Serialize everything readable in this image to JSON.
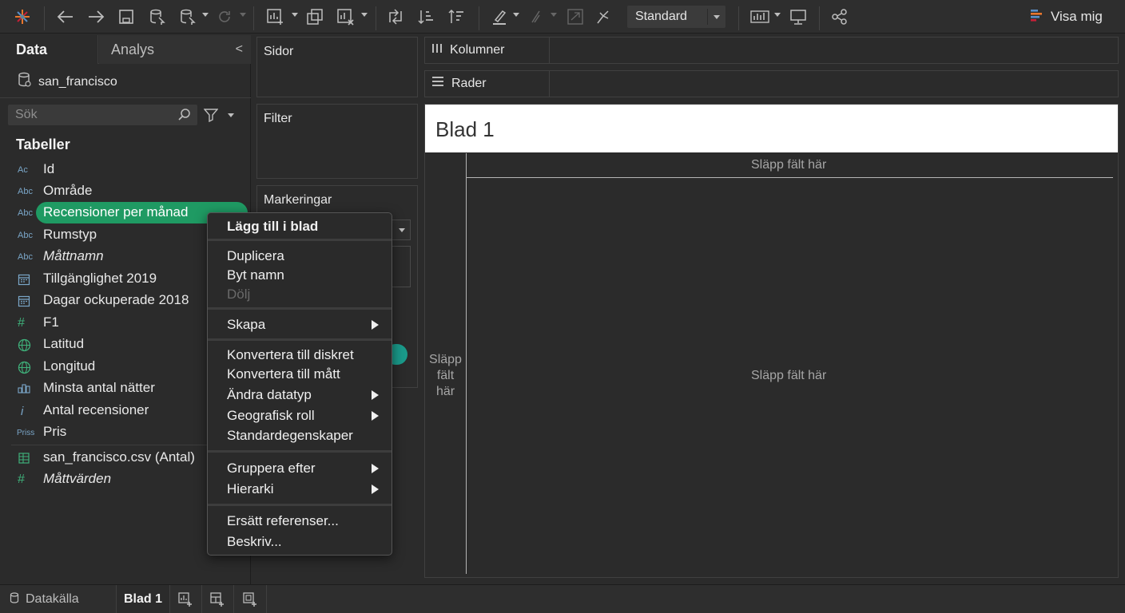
{
  "toolbar": {
    "format_select": "Standard",
    "show_me_label": "Visa mig"
  },
  "data_pane": {
    "tab_data": "Data",
    "tab_analys": "Analys",
    "collapse_glyph": "<",
    "datasource": "san_francisco",
    "search_placeholder": "Sök",
    "tables_heading": "Tabeller",
    "fields": [
      {
        "icon": "Ac",
        "label": "Id"
      },
      {
        "icon": "Abc",
        "label": "Område"
      },
      {
        "icon": "Abc",
        "label": "Recensioner per månad"
      },
      {
        "icon": "Abc",
        "label": "Rumstyp"
      },
      {
        "icon": "Abc",
        "label": "Måttnamn"
      },
      {
        "icon": "calendar-icon",
        "label": "Tillgänglighet 2019"
      },
      {
        "icon": "calendar-icon",
        "label": "Dagar ockuperade 2018"
      },
      {
        "icon": "#",
        "label": "F1"
      },
      {
        "icon": "globe-icon",
        "label": "Latitud"
      },
      {
        "icon": "globe-icon",
        "label": "Longitud"
      },
      {
        "icon": "bins-icon",
        "label": "Minsta antal nätter"
      },
      {
        "icon": "i",
        "label": "Antal recensioner"
      },
      {
        "icon": "Priss",
        "label": "Pris"
      },
      {
        "icon": "table-icon",
        "label": "san_francisco.csv (Antal)"
      },
      {
        "icon": "#",
        "label": "Måttvärden"
      }
    ]
  },
  "shelves": {
    "pages": "Sidor",
    "filters": "Filter",
    "marks": "Markeringar",
    "columns": "Kolumner",
    "rows": "Rader"
  },
  "canvas": {
    "sheet_title": "Blad 1",
    "drop_top": "Släpp fält här",
    "drop_left": [
      "Släpp",
      "fält",
      "här"
    ],
    "drop_center": "Släpp fält här"
  },
  "context_menu": {
    "add_to_sheet": "Lägg till i blad",
    "duplicate": "Duplicera",
    "rename": "Byt namn",
    "hide": "Dölj",
    "create": "Skapa",
    "convert_discrete": "Konvertera till diskret",
    "convert_measure": "Konvertera till mått",
    "change_datatype": "Ändra datatyp",
    "geo_role": "Geografisk roll",
    "default_props": "Standardegenskaper",
    "group_by": "Gruppera efter",
    "hierarchy": "Hierarki",
    "replace_refs": "Ersätt referenser...",
    "describe": "Beskriv..."
  },
  "bottom_bar": {
    "datasource_tab": "Datakälla",
    "sheet_tab": "Blad 1"
  },
  "colors": {
    "selection": "#1f9a63",
    "background": "#2b2b2b",
    "marks_accent": "#1a9a8a"
  }
}
